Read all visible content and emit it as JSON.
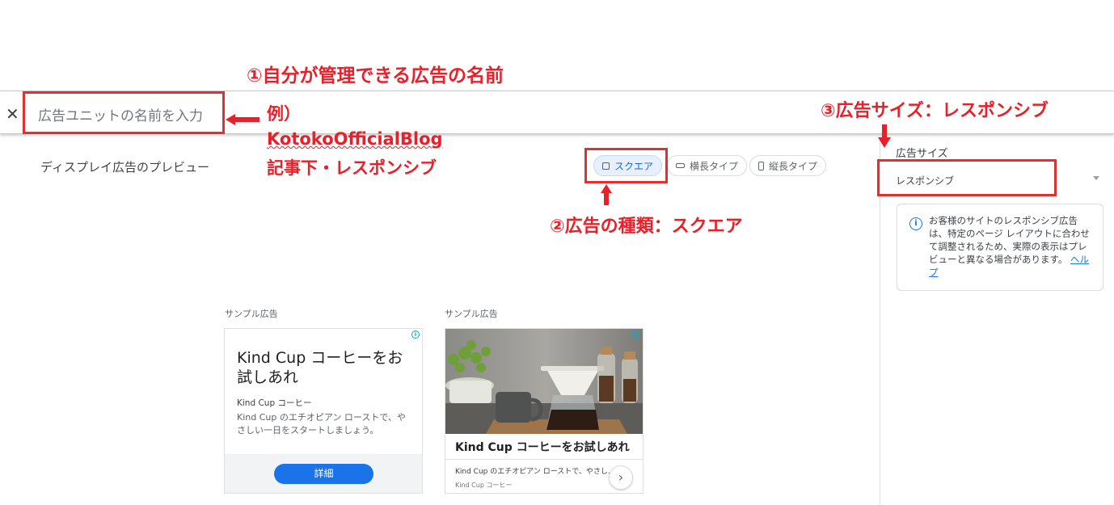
{
  "annotations": {
    "name_title": "①自分が管理できる広告の名前",
    "example_prefix": "例）",
    "example_site": "KotokoOfficialBlog",
    "example_placement": "記事下・レスポンシブ",
    "type_note": "②広告の種類：スクエア",
    "size_note": "③広告サイズ：レスポンシブ"
  },
  "header": {
    "close_symbol": "✕",
    "name_placeholder": "広告ユニットの名前を入力"
  },
  "preview": {
    "title": "ディスプレイ広告のプレビュー",
    "chips": [
      {
        "label": "スクエア",
        "active": true
      },
      {
        "label": "横長タイプ",
        "active": false
      },
      {
        "label": "縦長タイプ",
        "active": false
      }
    ]
  },
  "sidebar": {
    "size_label": "広告サイズ",
    "size_value": "レスポンシブ",
    "info_text": "お客様のサイトのレスポンシブ広告は、特定のページ レイアウトに合わせて調整されるため、実際の表示はプレビューと異なる場合があります。",
    "help_link": "ヘルプ"
  },
  "ads": [
    {
      "label": "サンプル広告",
      "headline": "Kind Cup コーヒーをお試しあれ",
      "advertiser": "Kind Cup コーヒー",
      "description": "Kind Cup のエチオピアン ローストで、やさしい一日をスタートしましょう。",
      "button": "詳細"
    },
    {
      "label": "サンプル広告",
      "headline": "Kind Cup コーヒーをお試しあれ",
      "description": "Kind Cup のエチオピアン ローストで、やさし...",
      "advertiser": "Kind Cup コーヒー",
      "next_symbol": "›"
    }
  ],
  "colors": {
    "annotation_red": "#e8202a",
    "accent_blue": "#1a73e8",
    "chip_active_bg": "#e8f0fe"
  }
}
